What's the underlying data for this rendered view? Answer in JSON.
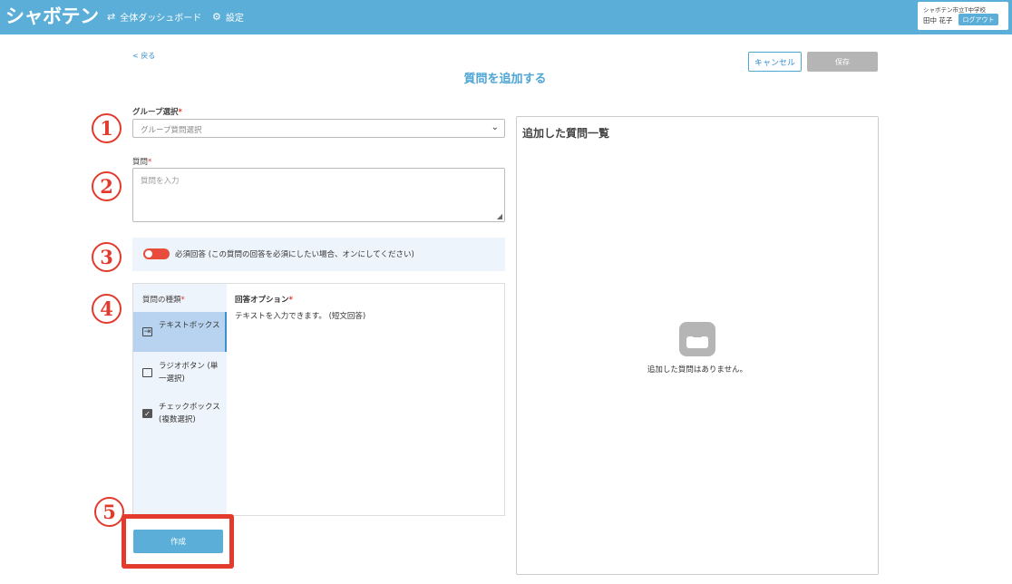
{
  "header": {
    "logo": "シャボテン",
    "nav": [
      {
        "icon": "refresh-icon",
        "label": "全体ダッシュボード"
      },
      {
        "icon": "gear-icon",
        "label": "設定"
      }
    ],
    "user": {
      "school": "シャボテン市立T中学校",
      "name": "田中 花子",
      "logout_label": "ログアウト"
    }
  },
  "top": {
    "back_label": "< 戻る",
    "title": "質問を追加する",
    "cancel_label": "キャンセル",
    "save_label": "保存"
  },
  "markers": [
    "1",
    "2",
    "3",
    "4",
    "5"
  ],
  "form": {
    "group": {
      "label": "グループ選択",
      "required": "*",
      "placeholder": "グループ質問選択"
    },
    "question": {
      "label": "質問",
      "required": "*",
      "placeholder": "質問を入力"
    },
    "required_toggle": {
      "on": true,
      "label": "必須回答 (この質問の回答を必須にしたい場合、オンにしてください)"
    },
    "types": {
      "header": "質問の種類",
      "required": "*",
      "items": [
        {
          "label": "テキストボックス",
          "icon": "text-input-icon",
          "active": true
        },
        {
          "label": "ラジオボタン (単一選択)",
          "icon": "empty-checkbox-icon",
          "active": false
        },
        {
          "label": "チェックボックス (複数選択)",
          "icon": "checked-checkbox-icon",
          "active": false
        }
      ]
    },
    "options": {
      "header": "回答オプション",
      "required": "*",
      "text": "テキストを入力できます。 (短文回答)"
    },
    "create_label": "作成"
  },
  "panel": {
    "title": "追加した質問一覧",
    "empty_icon": "inbox-icon",
    "empty_text": "追加した質問はありません。"
  },
  "colors": {
    "header_bg": "#5aaed8",
    "accent": "#4ea6d4",
    "marker": "#e23a2d",
    "toggle_on": "#e74c3c"
  }
}
